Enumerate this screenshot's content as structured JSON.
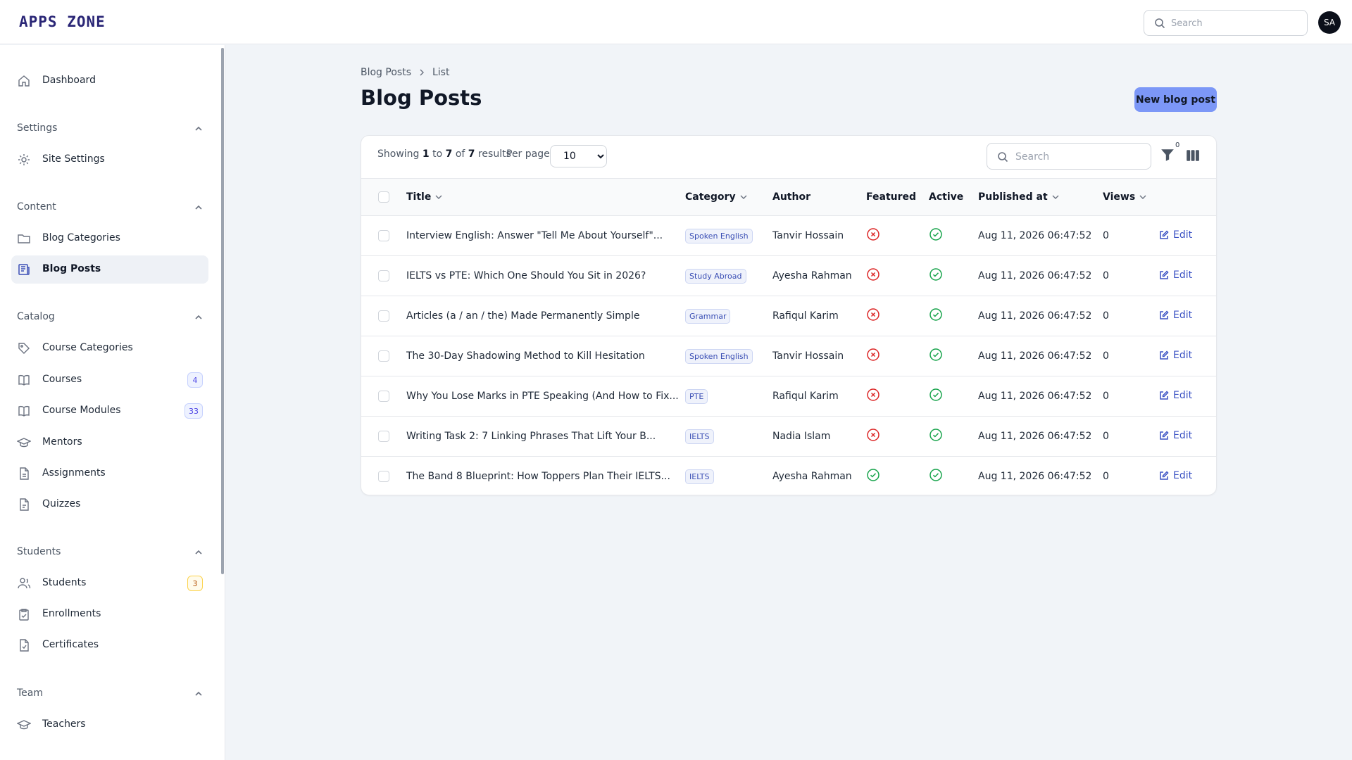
{
  "app": {
    "logo": "APPS ZONE",
    "user_initials": "SA",
    "search_placeholder": "Search"
  },
  "sidebar": {
    "dashboard": "Dashboard",
    "groups": {
      "settings": "Settings",
      "content": "Content",
      "catalog": "Catalog",
      "students": "Students",
      "team": "Team"
    },
    "items": {
      "site_settings": "Site Settings",
      "blog_categories": "Blog Categories",
      "blog_posts": "Blog Posts",
      "course_categories": "Course Categories",
      "courses": "Courses",
      "courses_badge": "4",
      "course_modules": "Course Modules",
      "course_modules_badge": "33",
      "mentors": "Mentors",
      "assignments": "Assignments",
      "quizzes": "Quizzes",
      "students": "Students",
      "students_badge": "3",
      "enrollments": "Enrollments",
      "certificates": "Certificates",
      "teachers": "Teachers"
    }
  },
  "breadcrumb": {
    "parent": "Blog Posts",
    "current": "List"
  },
  "page": {
    "title": "Blog Posts",
    "new_button": "New blog post"
  },
  "table_toolbar": {
    "showing_prefix": "Showing",
    "from": "1",
    "to_word": "to",
    "to": "7",
    "of_word": "of",
    "total": "7",
    "results_word": "results",
    "per_page_label": "Per page",
    "per_page_value": "10",
    "search_placeholder": "Search",
    "filter_count": "0"
  },
  "table": {
    "columns": {
      "title": "Title",
      "category": "Category",
      "author": "Author",
      "featured": "Featured",
      "active": "Active",
      "published_at": "Published at",
      "views": "Views"
    },
    "edit_label": "Edit",
    "rows": [
      {
        "title": "Interview English: Answer \"Tell Me About Yourself\"...",
        "category": "Spoken English",
        "author": "Tanvir Hossain",
        "featured": false,
        "active": true,
        "published_at": "Aug 11, 2026 06:47:52",
        "views": "0"
      },
      {
        "title": "IELTS vs PTE: Which One Should You Sit in 2026?",
        "category": "Study Abroad",
        "author": "Ayesha Rahman",
        "featured": false,
        "active": true,
        "published_at": "Aug 11, 2026 06:47:52",
        "views": "0"
      },
      {
        "title": "Articles (a / an / the) Made Permanently Simple",
        "category": "Grammar",
        "author": "Rafiqul Karim",
        "featured": false,
        "active": true,
        "published_at": "Aug 11, 2026 06:47:52",
        "views": "0"
      },
      {
        "title": "The 30-Day Shadowing Method to Kill Hesitation",
        "category": "Spoken English",
        "author": "Tanvir Hossain",
        "featured": false,
        "active": true,
        "published_at": "Aug 11, 2026 06:47:52",
        "views": "0"
      },
      {
        "title": "Why You Lose Marks in PTE Speaking (And How to Fix...",
        "category": "PTE",
        "author": "Rafiqul Karim",
        "featured": false,
        "active": true,
        "published_at": "Aug 11, 2026 06:47:52",
        "views": "0"
      },
      {
        "title": "Writing Task 2: 7 Linking Phrases That Lift Your B...",
        "category": "IELTS",
        "author": "Nadia Islam",
        "featured": false,
        "active": true,
        "published_at": "Aug 11, 2026 06:47:52",
        "views": "0"
      },
      {
        "title": "The Band 8 Blueprint: How Toppers Plan Their IELTS...",
        "category": "IELTS",
        "author": "Ayesha Rahman",
        "featured": true,
        "active": true,
        "published_at": "Aug 11, 2026 06:47:52",
        "views": "0"
      }
    ]
  },
  "colors": {
    "accent": "#7c97f7",
    "true_icon": "#16a34a",
    "false_icon": "#dc2626",
    "link": "#3b52c4"
  }
}
